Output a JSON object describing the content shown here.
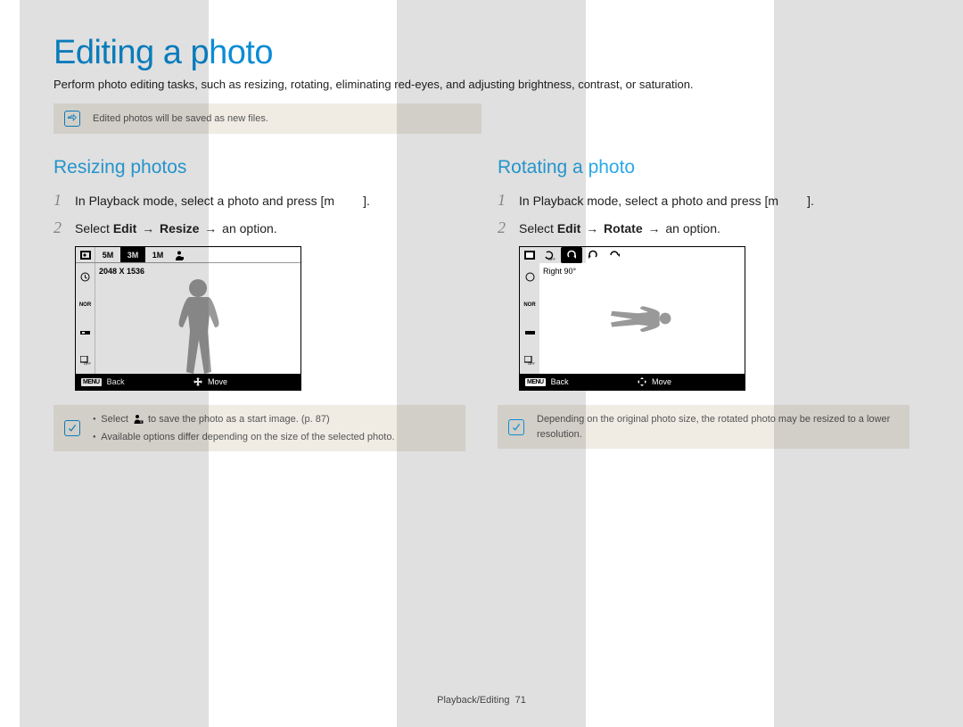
{
  "page": {
    "title": "Editing a photo",
    "intro": "Perform photo editing tasks, such as resizing, rotating, eliminating red-eyes, and adjusting brightness, contrast, or saturation.",
    "footer_section": "Playback/Editing",
    "footer_page": "71"
  },
  "top_note": {
    "text": "Edited photos will be saved as new files."
  },
  "left": {
    "heading": "Resizing photos",
    "step1_prefix": "In Playback mode, select a photo and press [",
    "step1_key": "m",
    "step1_suffix": "].",
    "step2_a": "Select ",
    "step2_b": "Edit",
    "step2_c": "Resize",
    "step2_d": " an option.",
    "screen": {
      "size_options": [
        "5M",
        "3M",
        "1M"
      ],
      "selected_option": "3M",
      "resolution": "2048 X 1536",
      "back": "Back",
      "move": "Move",
      "menu": "MENU"
    },
    "note_line1_a": "Select ",
    "note_line1_b": " to save the photo as a start image. (p. 87)",
    "note_line2": "Available options differ depending on the size of the selected photo."
  },
  "right": {
    "heading": "Rotating a photo",
    "step1_prefix": "In Playback mode, select a photo and press [",
    "step1_key": "m",
    "step1_suffix": "].",
    "step2_a": "Select ",
    "step2_b": "Edit",
    "step2_c": "Rotate",
    "step2_d": " an option.",
    "screen": {
      "label": "Right 90°",
      "back": "Back",
      "move": "Move",
      "menu": "MENU"
    },
    "note": "Depending on the original photo size, the rotated photo may be resized to a lower resolution."
  },
  "icons": {
    "arrow": "→"
  }
}
